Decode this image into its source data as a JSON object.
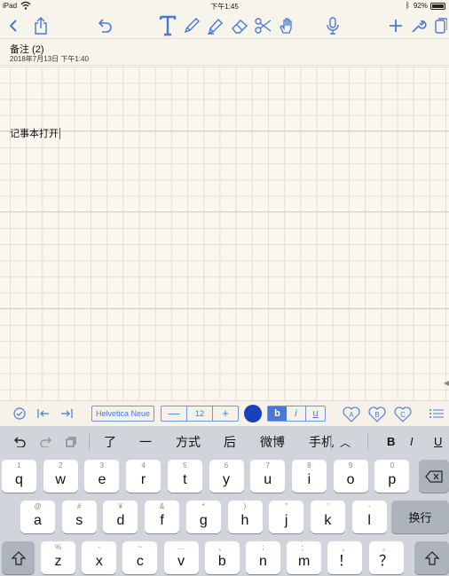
{
  "status": {
    "device": "iPad",
    "time": "下午1:45",
    "battery": "92%"
  },
  "note": {
    "title": "备注 (2)",
    "date": "2018年7月13日 下午1:40",
    "body": "记事本打开"
  },
  "format": {
    "font_name": "Helvetica Neue",
    "minus": "—",
    "font_size": "12",
    "plus": "+",
    "bold": "b",
    "italic": "i",
    "underline": "u",
    "heart_a": "A",
    "heart_b": "B",
    "heart_c": "C",
    "text_color": "#1a40b8"
  },
  "keyboard": {
    "suggestions": [
      "了",
      "一",
      "方式",
      "后",
      "微博",
      "手机"
    ],
    "format_buttons": {
      "bold": "B",
      "italic": "I",
      "underline": "U"
    },
    "row1": [
      {
        "k": "q",
        "h": "1"
      },
      {
        "k": "w",
        "h": "2"
      },
      {
        "k": "e",
        "h": "3"
      },
      {
        "k": "r",
        "h": "4"
      },
      {
        "k": "t",
        "h": "5"
      },
      {
        "k": "y",
        "h": "6"
      },
      {
        "k": "u",
        "h": "7"
      },
      {
        "k": "i",
        "h": "8"
      },
      {
        "k": "o",
        "h": "9"
      },
      {
        "k": "p",
        "h": "0"
      }
    ],
    "row2": [
      {
        "k": "a",
        "h": "@"
      },
      {
        "k": "s",
        "h": "#"
      },
      {
        "k": "d",
        "h": "¥"
      },
      {
        "k": "f",
        "h": "&"
      },
      {
        "k": "g",
        "h": "*"
      },
      {
        "k": "h",
        "h": ")"
      },
      {
        "k": "j",
        "h": "\""
      },
      {
        "k": "k",
        "h": "'"
      },
      {
        "k": "l",
        "h": "-"
      }
    ],
    "row3": [
      {
        "k": "z",
        "h": "%"
      },
      {
        "k": "x",
        "h": "-"
      },
      {
        "k": "c",
        "h": "~"
      },
      {
        "k": "v",
        "h": "…"
      },
      {
        "k": "b",
        "h": "、"
      },
      {
        "k": "n",
        "h": ";"
      },
      {
        "k": "m",
        "h": "："
      },
      {
        "k": "！",
        "h": "，"
      },
      {
        "k": "？",
        "h": "。"
      }
    ],
    "return_label": "换行"
  }
}
